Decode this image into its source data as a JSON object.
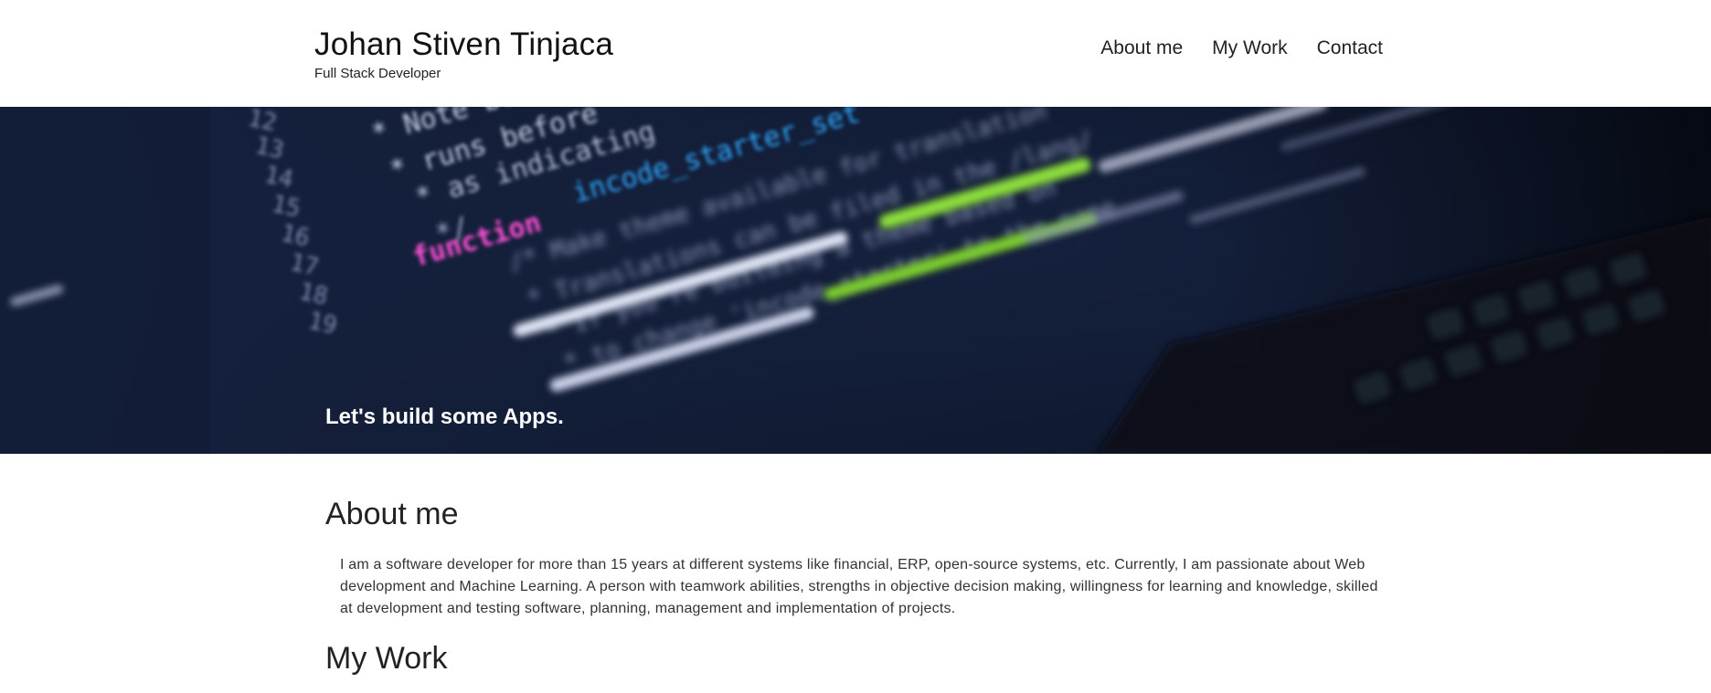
{
  "header": {
    "name": "Johan Stiven Tinjaca",
    "role": "Full Stack Developer",
    "nav": [
      "About me",
      "My Work",
      "Contact"
    ]
  },
  "hero": {
    "tagline": "Let's build some Apps."
  },
  "about": {
    "title": "About me",
    "text": "I am a software developer for more than 15 years at different systems like financial, ERP, open-source systems, etc. Currently, I am passionate about Web development and Machine Learning. A person with teamwork abilities, strengths in objective decision making, willingness for learning and knowledge, skilled at development and testing software, planning, management and implementation of projects."
  },
  "work": {
    "title": "My Work"
  },
  "colors": {
    "background": "#ffffff",
    "text": "#222222",
    "hero_dark": "#0a1124",
    "code_blue": "#2fa8ff",
    "code_pink": "#ff4fd8",
    "code_green": "#8cdc3c"
  }
}
